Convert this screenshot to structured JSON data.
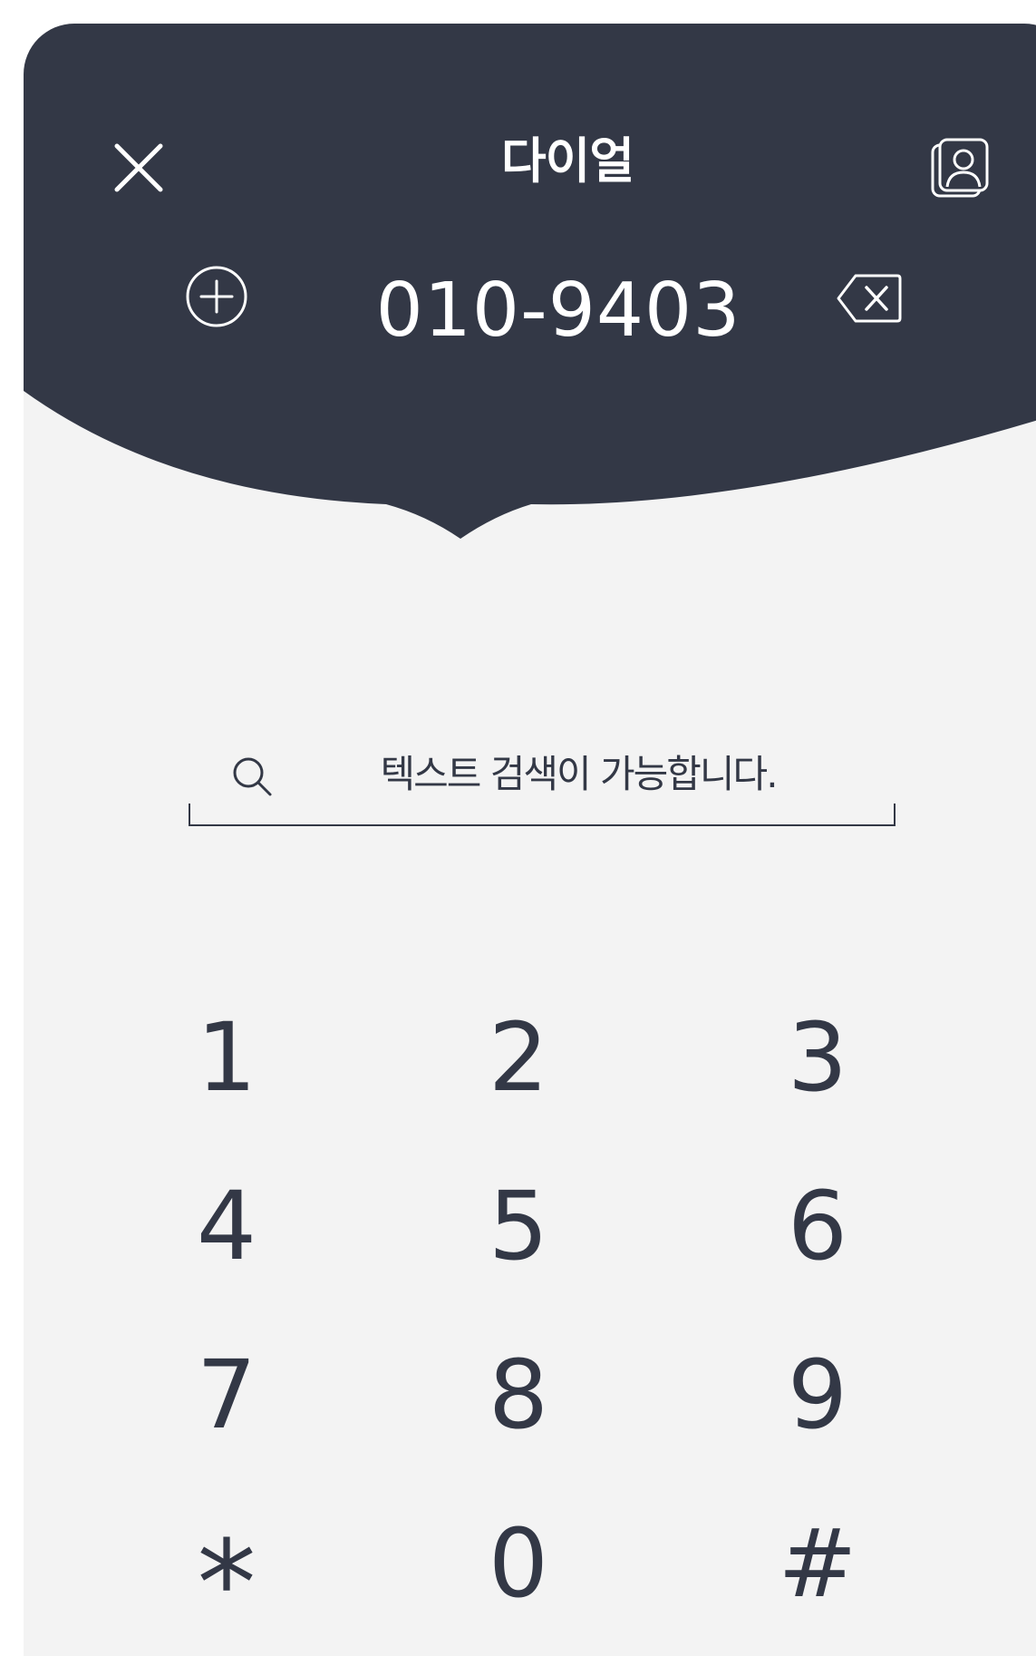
{
  "header": {
    "title": "다이얼",
    "number": "010-9403",
    "background_color": "#333846",
    "close_icon": "close-icon",
    "contacts_icon": "contacts-icon",
    "add_icon": "add-circle-icon",
    "backspace_icon": "backspace-icon"
  },
  "search": {
    "placeholder": "텍스트 검색이 가능합니다.",
    "icon": "search-icon"
  },
  "keypad": {
    "keys": [
      "1",
      "2",
      "3",
      "4",
      "5",
      "6",
      "7",
      "8",
      "9",
      "*",
      "0",
      "#"
    ]
  },
  "colors": {
    "header_bg": "#333846",
    "body_bg": "#f3f3f3",
    "text": "#333846"
  }
}
